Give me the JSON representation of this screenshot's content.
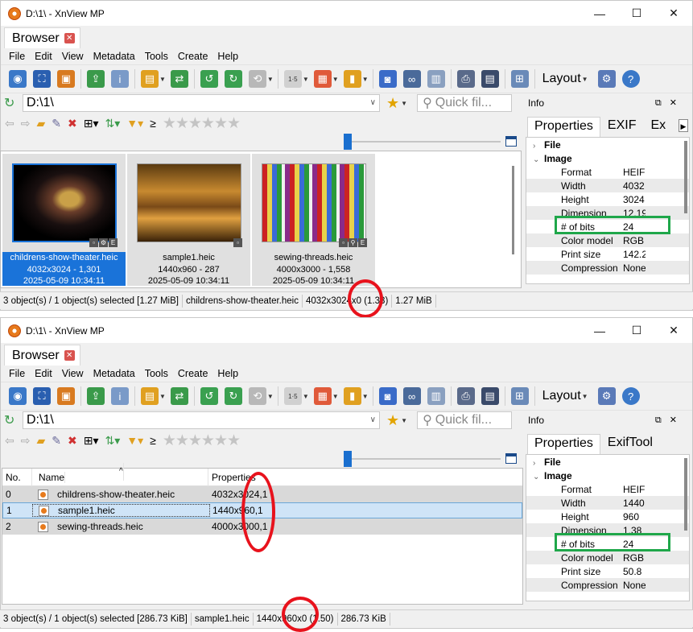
{
  "top": {
    "title": "D:\\1\\ - XnView MP",
    "tab": "Browser",
    "menu": [
      "File",
      "Edit",
      "View",
      "Metadata",
      "Tools",
      "Create",
      "Help"
    ],
    "layout_label": "Layout",
    "address": "D:\\1\\",
    "quick_filter": "Quick fil...",
    "ge": "≥",
    "thumbnails": [
      {
        "name": "childrens-show-theater.heic",
        "info": "4032x3024 - 1,301",
        "date": "2025-05-09 10:34:11",
        "selected": true
      },
      {
        "name": "sample1.heic",
        "info": "1440x960 - 287",
        "date": "2025-05-09 10:34:11",
        "selected": false
      },
      {
        "name": "sewing-threads.heic",
        "info": "4000x3000 - 1,558",
        "date": "2025-05-09 10:34:11",
        "selected": false
      }
    ],
    "status": [
      "3 object(s) / 1 object(s) selected [1.27 MiB]",
      "childrens-show-theater.heic",
      "4032x3024x0 (1.33)",
      "1.27 MiB"
    ],
    "info_title": "Info",
    "info_tabs": [
      "Properties",
      "EXIF",
      "Ex"
    ],
    "props": [
      {
        "k": "File",
        "v": "",
        "grp": true
      },
      {
        "k": "Image",
        "v": "",
        "grp": true
      },
      {
        "k": "Format",
        "v": "HEIF"
      },
      {
        "k": "Width",
        "v": "4032"
      },
      {
        "k": "Height",
        "v": "3024"
      },
      {
        "k": "Dimension",
        "v": "12.19"
      },
      {
        "k": "# of bits",
        "v": "24"
      },
      {
        "k": "Color model",
        "v": "RGB"
      },
      {
        "k": "Print size",
        "v": "142.2"
      },
      {
        "k": "Compression",
        "v": "None"
      }
    ]
  },
  "bottom": {
    "title": "D:\\1\\ - XnView MP",
    "tab": "Browser",
    "menu": [
      "File",
      "Edit",
      "View",
      "Metadata",
      "Tools",
      "Create",
      "Help"
    ],
    "layout_label": "Layout",
    "address": "D:\\1\\",
    "quick_filter": "Quick fil...",
    "ge": "≥",
    "columns": [
      "No.",
      "Name",
      "Properties"
    ],
    "rows": [
      {
        "no": "0",
        "name": "childrens-show-theater.heic",
        "props": "4032x3024,1"
      },
      {
        "no": "1",
        "name": "sample1.heic",
        "props": "1440x960,1"
      },
      {
        "no": "2",
        "name": "sewing-threads.heic",
        "props": "4000x3000,1"
      }
    ],
    "status": [
      "3 object(s) / 1 object(s) selected [286.73 KiB]",
      "sample1.heic",
      "1440x960x0 (1.50)",
      "286.73 KiB"
    ],
    "info_title": "Info",
    "info_tabs": [
      "Properties",
      "ExifTool"
    ],
    "props": [
      {
        "k": "File",
        "v": "",
        "grp": true
      },
      {
        "k": "Image",
        "v": "",
        "grp": true
      },
      {
        "k": "Format",
        "v": "HEIF"
      },
      {
        "k": "Width",
        "v": "1440"
      },
      {
        "k": "Height",
        "v": "960"
      },
      {
        "k": "Dimension",
        "v": "1.38"
      },
      {
        "k": "# of bits",
        "v": "24"
      },
      {
        "k": "Color model",
        "v": "RGB"
      },
      {
        "k": "Print size",
        "v": "50.8"
      },
      {
        "k": "Compression",
        "v": "None"
      }
    ]
  },
  "colors": {
    "accent": "#1a73d9",
    "highlight_box": "#1fa74a",
    "annotation": "#e8121c"
  }
}
